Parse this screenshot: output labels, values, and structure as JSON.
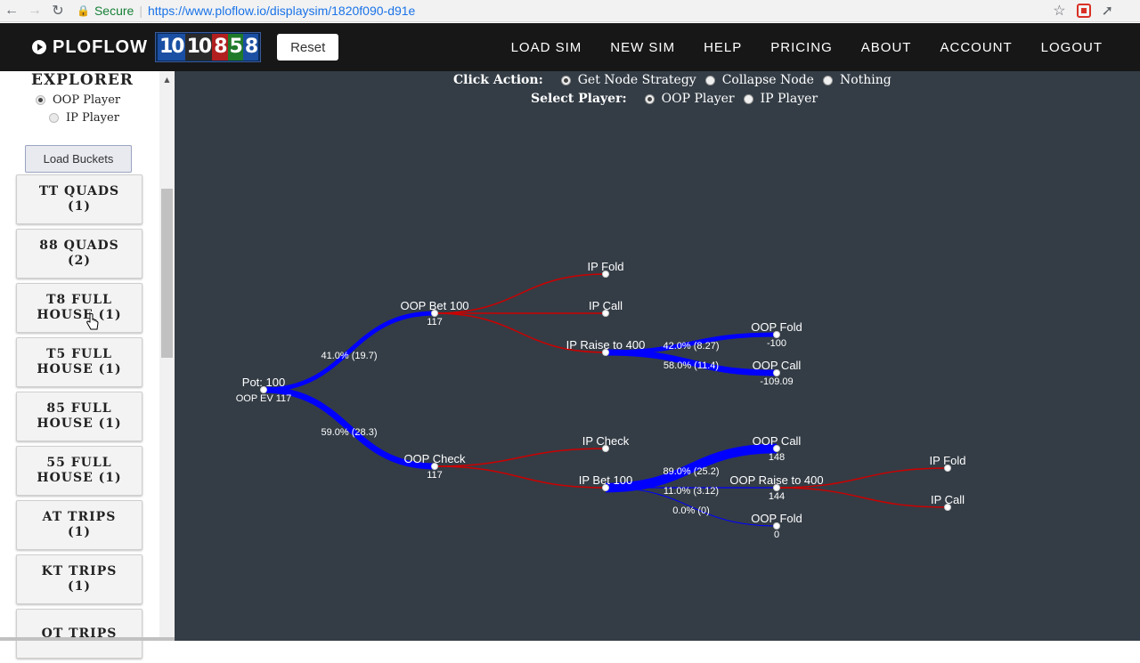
{
  "browser": {
    "secure_label": "Secure",
    "url": "https://www.ploflow.io/displaysim/1820f090-d91e"
  },
  "header": {
    "logo_text": "PLOFLOW",
    "board_cards": [
      "10",
      "10",
      "8",
      "5",
      "8"
    ],
    "reset_label": "Reset",
    "menu": [
      "LOAD SIM",
      "NEW SIM",
      "HELP",
      "PRICING",
      "ABOUT",
      "ACCOUNT",
      "LOGOUT"
    ]
  },
  "sidebar": {
    "title": "EXPLORER",
    "player_options": [
      {
        "label": "OOP Player",
        "selected": true
      },
      {
        "label": "IP Player",
        "selected": false
      }
    ],
    "load_buckets_label": "Load Buckets",
    "buckets": [
      "TT QUADS (1)",
      "88 QUADS (2)",
      "T8 FULL HOUSE (1)",
      "T5 FULL HOUSE (1)",
      "85 FULL HOUSE (1)",
      "55 FULL HOUSE (1)",
      "AT TRIPS (1)",
      "KT TRIPS (1)",
      "QT TRIPS"
    ]
  },
  "controls": {
    "click_action_label": "Click Action:",
    "click_actions": [
      {
        "label": "Get Node Strategy",
        "selected": true
      },
      {
        "label": "Collapse Node",
        "selected": false
      },
      {
        "label": "Nothing",
        "selected": false
      }
    ],
    "select_player_label": "Select Player:",
    "players": [
      {
        "label": "OOP Player",
        "selected": true
      },
      {
        "label": "IP Player",
        "selected": false
      }
    ]
  },
  "colors": {
    "oop_edge": "#0000ff",
    "ip_edge": "#cc0000",
    "background": "#343d46"
  },
  "tree": {
    "nodes": [
      {
        "id": "root",
        "label": "Pot: 100",
        "sub": "OOP EV 117"
      },
      {
        "id": "oop_bet",
        "label": "OOP Bet 100",
        "sub": "117"
      },
      {
        "id": "oop_check",
        "label": "OOP Check",
        "sub": "117"
      },
      {
        "id": "ip_fold_1",
        "label": "IP Fold",
        "sub": ""
      },
      {
        "id": "ip_call_1",
        "label": "IP Call",
        "sub": ""
      },
      {
        "id": "ip_raise",
        "label": "IP Raise to 400",
        "sub": ""
      },
      {
        "id": "oop_fold_1",
        "label": "OOP Fold",
        "sub": "-100"
      },
      {
        "id": "oop_call_1",
        "label": "OOP Call",
        "sub": "-109.09"
      },
      {
        "id": "ip_check",
        "label": "IP Check",
        "sub": ""
      },
      {
        "id": "ip_bet",
        "label": "IP Bet 100",
        "sub": ""
      },
      {
        "id": "oop_call_2",
        "label": "OOP Call",
        "sub": "148"
      },
      {
        "id": "oop_raise",
        "label": "OOP Raise to 400",
        "sub": "144"
      },
      {
        "id": "oop_fold_2",
        "label": "OOP Fold",
        "sub": "0"
      },
      {
        "id": "ip_fold_2",
        "label": "IP Fold",
        "sub": ""
      },
      {
        "id": "ip_call_2",
        "label": "IP Call",
        "sub": ""
      }
    ],
    "edges": [
      {
        "from": "root",
        "to": "oop_bet",
        "player": "oop",
        "freq": 0.41,
        "label": "41.0% (19.7)"
      },
      {
        "from": "root",
        "to": "oop_check",
        "player": "oop",
        "freq": 0.59,
        "label": "59.0% (28.3)"
      },
      {
        "from": "oop_bet",
        "to": "ip_fold_1",
        "player": "ip",
        "freq": 0,
        "label": ""
      },
      {
        "from": "oop_bet",
        "to": "ip_call_1",
        "player": "ip",
        "freq": 0,
        "label": ""
      },
      {
        "from": "oop_bet",
        "to": "ip_raise",
        "player": "ip",
        "freq": 0,
        "label": ""
      },
      {
        "from": "ip_raise",
        "to": "oop_fold_1",
        "player": "oop",
        "freq": 0.42,
        "label": "42.0% (8.27)"
      },
      {
        "from": "ip_raise",
        "to": "oop_call_1",
        "player": "oop",
        "freq": 0.58,
        "label": "58.0% (11.4)"
      },
      {
        "from": "oop_check",
        "to": "ip_check",
        "player": "ip",
        "freq": 0,
        "label": ""
      },
      {
        "from": "oop_check",
        "to": "ip_bet",
        "player": "ip",
        "freq": 0,
        "label": ""
      },
      {
        "from": "ip_bet",
        "to": "oop_call_2",
        "player": "oop",
        "freq": 0.89,
        "label": "89.0% (25.2)"
      },
      {
        "from": "ip_bet",
        "to": "oop_raise",
        "player": "oop",
        "freq": 0.11,
        "label": "11.0% (3.12)"
      },
      {
        "from": "ip_bet",
        "to": "oop_fold_2",
        "player": "oop",
        "freq": 0.0,
        "label": "0.0% (0)"
      },
      {
        "from": "oop_raise",
        "to": "ip_fold_2",
        "player": "ip",
        "freq": 0,
        "label": ""
      },
      {
        "from": "oop_raise",
        "to": "ip_call_2",
        "player": "ip",
        "freq": 0,
        "label": ""
      }
    ]
  }
}
